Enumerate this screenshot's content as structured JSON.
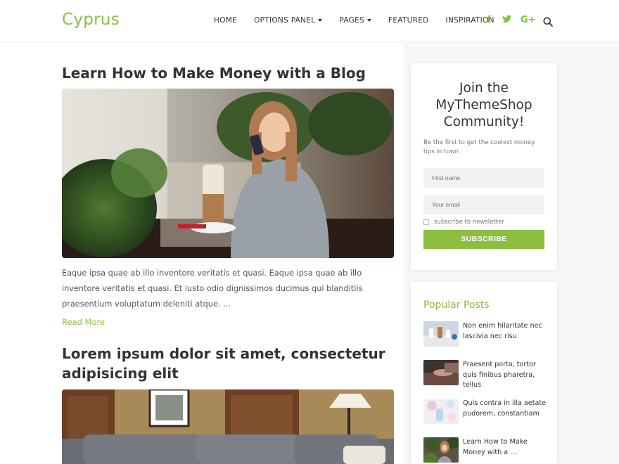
{
  "site": {
    "logo": "Cyprus"
  },
  "nav": {
    "items": [
      {
        "label": "HOME"
      },
      {
        "label": "OPTIONS PANEL"
      },
      {
        "label": "PAGES"
      },
      {
        "label": "FEATURED"
      },
      {
        "label": "INSPIRATION"
      }
    ],
    "social": {
      "facebook": "f",
      "twitter": "t",
      "googleplus": "G+"
    }
  },
  "posts": [
    {
      "title": "Learn How to Make Money with a Blog",
      "excerpt": "Eaque ipsa quae ab illo inventore veritatis et quasi. Eaque ipsa quae ab illo inventore veritatis et quasi. Et iusto odio dignissimos ducimus qui blanditiis praesentium voluptatum deleniti atque. ...",
      "read_more": "Read More"
    },
    {
      "title": "Lorem ipsum dolor sit amet, consectetur adipisicing elit"
    }
  ],
  "newsletter": {
    "title": "Join the MyThemeShop Community!",
    "subtitle": "Be the first to get the coolest money tips in town",
    "first_name_placeholder": "First name",
    "email_placeholder": "Your email",
    "checkbox_label": "subscribe to newsletter",
    "button_label": "SUBSCRIBE"
  },
  "popular": {
    "title": "Popular Posts",
    "items": [
      {
        "title": "Non enim hilaritate nec lascivia nec risu"
      },
      {
        "title": "Praesent porta, tortor quis finibus pharetra, tellus"
      },
      {
        "title": "Quis contra in illa aetate pudorem, constantiam"
      },
      {
        "title": "Learn How to Make Money with a ..."
      }
    ]
  },
  "colors": {
    "accent": "#8cbf3f",
    "heading": "#333333"
  }
}
